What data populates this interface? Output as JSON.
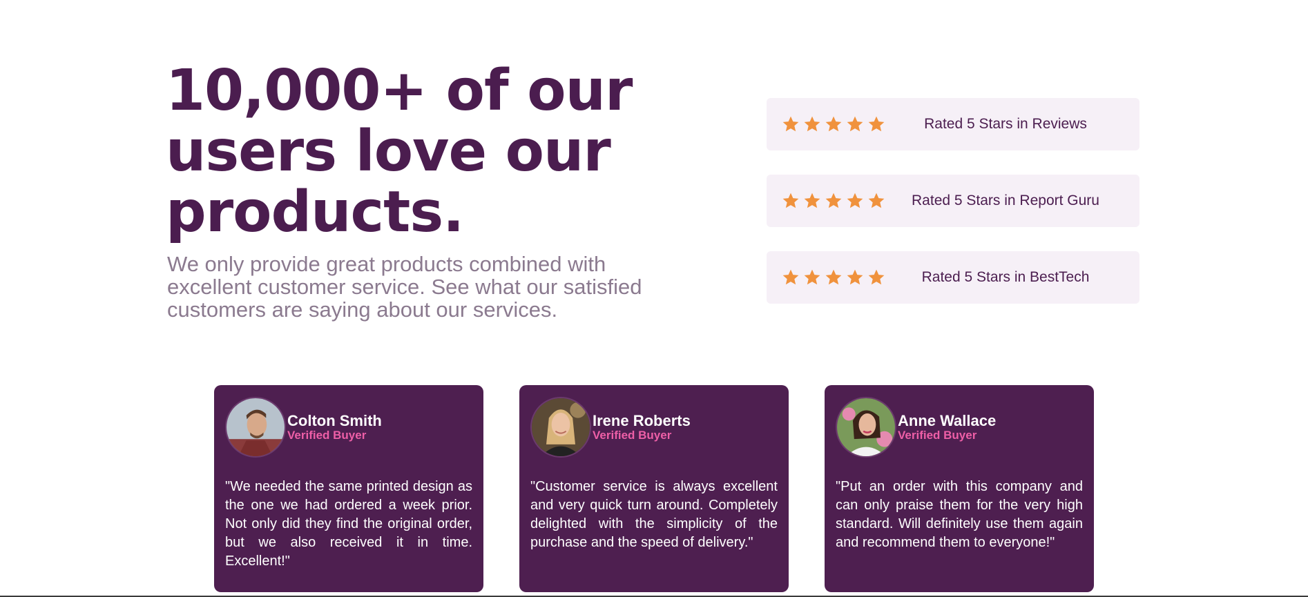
{
  "hero": {
    "title": "10,000+ of our users love our products.",
    "subtitle": "We only provide great products combined with excellent customer service. See what our satisfied customers are saying about our services."
  },
  "ratings": [
    {
      "stars": 5,
      "label": "Rated 5 Stars in Reviews"
    },
    {
      "stars": 5,
      "label": "Rated 5 Stars in Report Guru"
    },
    {
      "stars": 5,
      "label": "Rated 5 Stars in BestTech"
    }
  ],
  "testimonials": [
    {
      "name": "Colton Smith",
      "badge": "Verified Buyer",
      "quote": "\"We needed the same printed design as the one we had ordered a week prior. Not only did they find the original order, but we also received it in time. Excellent!\""
    },
    {
      "name": "Irene Roberts",
      "badge": "Verified Buyer",
      "quote": "\"Customer service is always excellent and very quick turn around. Completely delighted with the simplicity of the purchase and the speed of delivery.\""
    },
    {
      "name": "Anne Wallace",
      "badge": "Verified Buyer",
      "quote": "\"Put an order with this company and can only praise them for the very high standard. Will definitely use them again and recommend them to everyone!\""
    }
  ],
  "colors": {
    "brand": "#4b1d4f",
    "card": "#4e1f50",
    "accent": "#ee5fa7",
    "star": "#f0923d",
    "rating_bg": "#f6f0f7"
  },
  "icons": {
    "star": "star-icon"
  }
}
